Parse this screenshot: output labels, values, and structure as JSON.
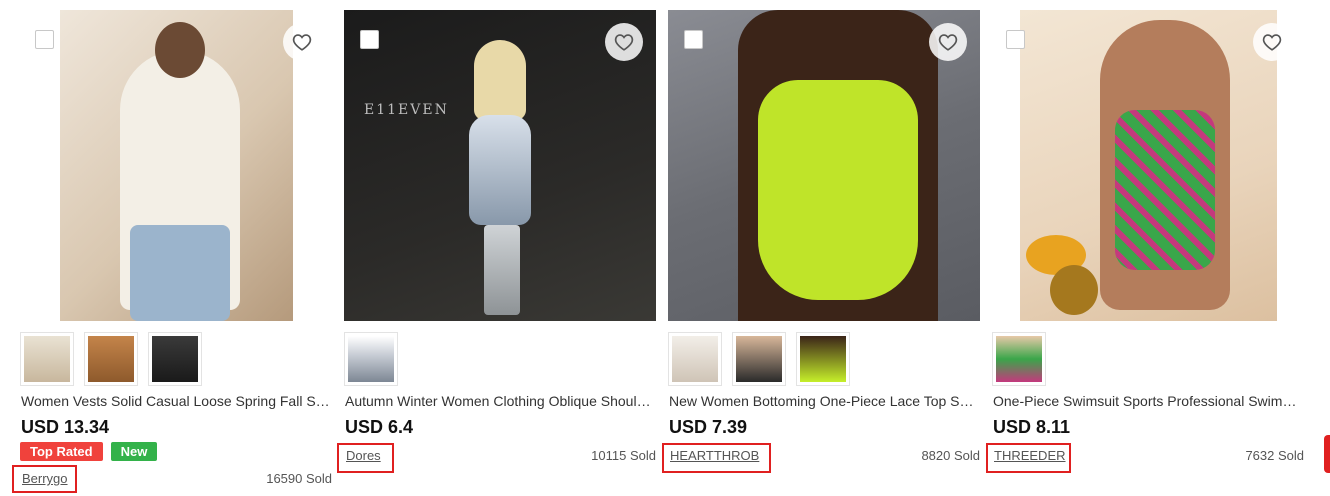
{
  "products": [
    {
      "title": "Women Vests Solid Casual Loose Spring Fall Singl...",
      "price": "USD 13.34",
      "badges": [
        {
          "label": "Top Rated",
          "color": "#f0423c"
        },
        {
          "label": "New",
          "color": "#33b24a"
        }
      ],
      "store": "Berrygo",
      "sold": "16590 Sold",
      "thumbnails": [
        "cream shacket",
        "brown shacket",
        "black shacket"
      ]
    },
    {
      "title": "Autumn Winter Women Clothing Oblique Shoulde...",
      "price": "USD 6.4",
      "badges": [],
      "store": "Dores",
      "sold": "10115 Sold",
      "thumbnails": [
        "silver dress"
      ]
    },
    {
      "title": "New Women Bottoming One-Piece Lace Top Sexy ...",
      "price": "USD 7.39",
      "badges": [],
      "store": "HEARTTHROB",
      "sold": "8820 Sold",
      "thumbnails": [
        "white lace bodysuit",
        "black lace bodysuit",
        "neon lace bodysuit"
      ]
    },
    {
      "title": "One-Piece Swimsuit Sports Professional Swimsuit ...",
      "price": "USD 8.11",
      "badges": [],
      "store": "THREEDER",
      "sold": "7632 Sold",
      "thumbnails": [
        "green pink swimsuit"
      ]
    }
  ],
  "photo_text": {
    "card2_backdrop": "E11EVEN"
  },
  "icons": {
    "wishlist": "heart-outline-icon",
    "select": "checkbox"
  },
  "colors": {
    "badge_top_rated": "#f0423c",
    "badge_new": "#33b24a",
    "highlight_box": "#e02020"
  }
}
